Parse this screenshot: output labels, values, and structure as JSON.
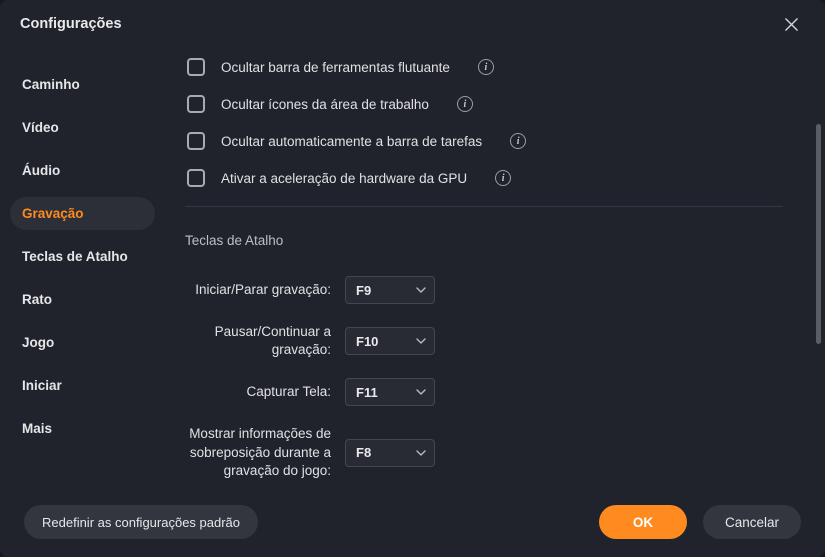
{
  "colors": {
    "accent": "#ff8a20",
    "bg": "#20232b"
  },
  "window": {
    "title": "Configurações"
  },
  "sidebar": {
    "items": [
      {
        "label": "Caminho"
      },
      {
        "label": "Vídeo"
      },
      {
        "label": "Áudio"
      },
      {
        "label": "Gravação"
      },
      {
        "label": "Teclas de Atalho"
      },
      {
        "label": "Rato"
      },
      {
        "label": "Jogo"
      },
      {
        "label": "Iniciar"
      },
      {
        "label": "Mais"
      }
    ],
    "active_index": 3
  },
  "options": [
    {
      "label": "Ocultar barra de ferramentas flutuante",
      "checked": false
    },
    {
      "label": "Ocultar ícones da área de trabalho",
      "checked": false
    },
    {
      "label": "Ocultar automaticamente a barra de tarefas",
      "checked": false
    },
    {
      "label": "Ativar a aceleração de hardware da GPU",
      "checked": false
    }
  ],
  "hotkeys": {
    "section_title": "Teclas de Atalho",
    "rows": [
      {
        "label": "Iniciar/Parar gravação:",
        "value": "F9"
      },
      {
        "label": "Pausar/Continuar  a gravação:",
        "value": "F10"
      },
      {
        "label": "Capturar Tela:",
        "value": "F11"
      },
      {
        "label": "Mostrar informações de sobreposição durante a gravação do jogo:",
        "value": "F8"
      }
    ]
  },
  "footer": {
    "reset": "Redefinir as configurações padrão",
    "ok": "OK",
    "cancel": "Cancelar"
  }
}
